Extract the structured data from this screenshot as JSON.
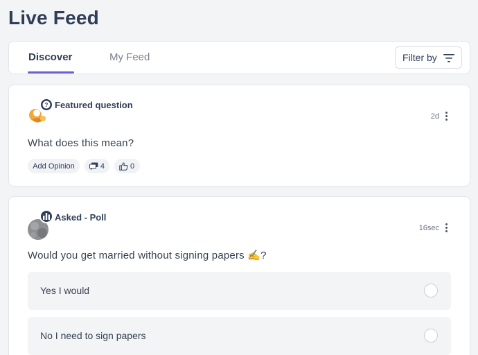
{
  "page": {
    "title": "Live Feed"
  },
  "tabs": [
    {
      "label": "Discover",
      "active": true
    },
    {
      "label": "My Feed",
      "active": false
    }
  ],
  "filter": {
    "label": "Filter by",
    "icon": "filter-icon"
  },
  "colors": {
    "accent": "#6d5fd3",
    "title": "#2f3e57",
    "background": "#f3f4f6"
  },
  "posts": [
    {
      "type_label": "Featured question",
      "badge_icon": "question-icon",
      "time": "2d",
      "question": "What does this mean?",
      "actions": {
        "opinion_label": "Add Opinion",
        "comments_count": "4",
        "likes_count": "0"
      }
    },
    {
      "type_label": "Asked - Poll",
      "badge_icon": "poll-chart-icon",
      "time": "16sec",
      "question": "Would you get married without signing papers ✍️?",
      "options": [
        {
          "label": "Yes I would"
        },
        {
          "label": "No I need to sign papers"
        }
      ]
    }
  ]
}
